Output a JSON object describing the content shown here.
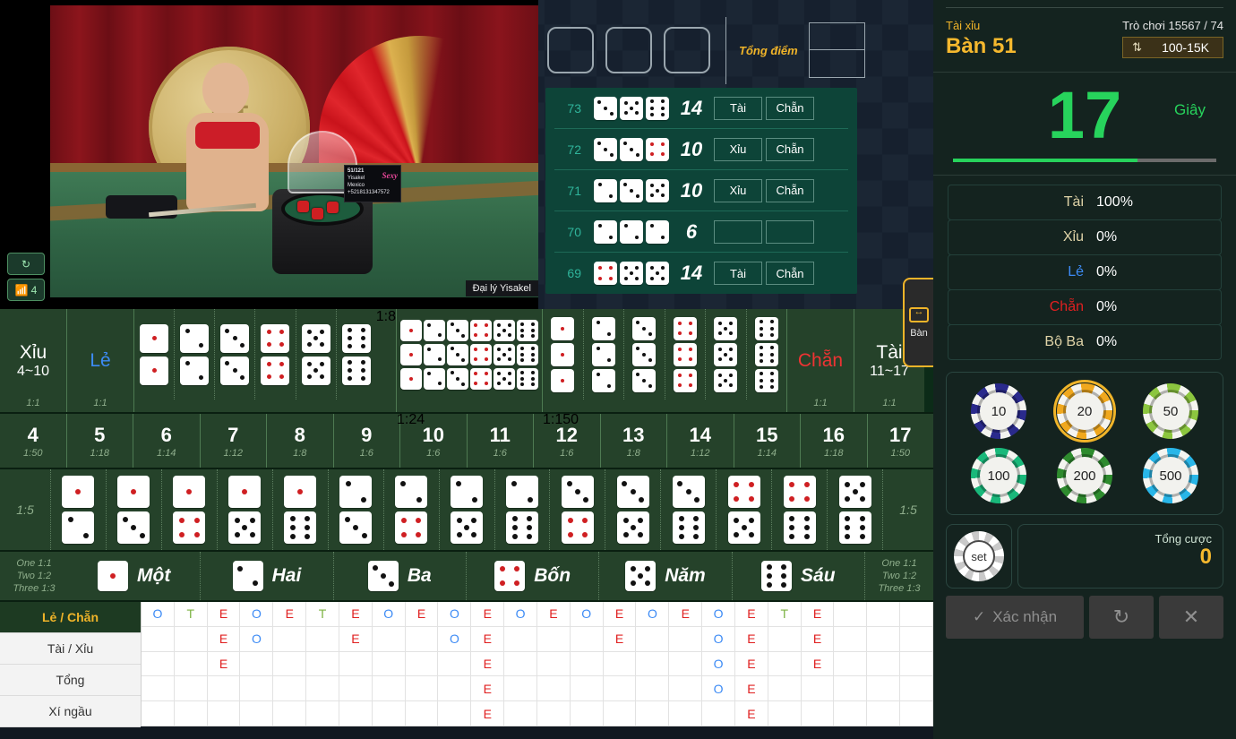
{
  "header": {
    "game_type": "Tài xỉu",
    "table_name": "Bàn 51",
    "game_number": "Trò chơi 15567 / 74",
    "limit": "100-15K",
    "limit_icon": "up-down-arrow-icon"
  },
  "timer": {
    "seconds": "17",
    "unit": "Giây",
    "progress_percent": 70
  },
  "stats": [
    {
      "label": "Tài",
      "value": "100%",
      "color": "#e0d4a8"
    },
    {
      "label": "Xỉu",
      "value": "0%",
      "color": "#e0d4a8"
    },
    {
      "label": "Lẻ",
      "value": "0%",
      "color": "#3d8bf5"
    },
    {
      "label": "Chẵn",
      "value": "0%",
      "color": "#e02020"
    },
    {
      "label": "Bộ Ba",
      "value": "0%",
      "color": "#e0d4a8"
    }
  ],
  "chips": [
    {
      "value": "10",
      "color": "#2a2a8c",
      "selected": false
    },
    {
      "value": "20",
      "color": "#f0a81e",
      "selected": true
    },
    {
      "value": "50",
      "color": "#8cc63f",
      "selected": false
    },
    {
      "value": "100",
      "color": "#19b87a",
      "selected": false
    },
    {
      "value": "200",
      "color": "#2e8b2e",
      "selected": false
    },
    {
      "value": "500",
      "color": "#29b6e8",
      "selected": false
    }
  ],
  "bet_controls": {
    "set_chip_label": "set",
    "total_bet_label": "Tổng cược",
    "total_bet_value": "0",
    "confirm_label": "Xác nhận",
    "repeat_icon": "repeat-icon",
    "clear_icon": "close-icon"
  },
  "side_tab": {
    "label": "Bàn",
    "icon": "resize-table-icon"
  },
  "video": {
    "refresh_icon": "refresh-icon",
    "signal_icon": "wifi-icon",
    "signal_level": "4",
    "dealer_label": "Đại lý Yisakel",
    "board": {
      "line1": "51/121",
      "line2": "Yisakel",
      "line3": "Mexico",
      "line4": "+5218131347572",
      "logo": "Sexy"
    }
  },
  "history_top": {
    "total_label": "Tổng điểm",
    "dice_slots": 3,
    "total_boxes": 2
  },
  "history": [
    {
      "round": "73",
      "dice": [
        3,
        5,
        6
      ],
      "dice_red": [
        false,
        false,
        false
      ],
      "sum": "14",
      "tags": [
        "Tài",
        "Chẵn"
      ]
    },
    {
      "round": "72",
      "dice": [
        3,
        3,
        4
      ],
      "dice_red": [
        false,
        false,
        true
      ],
      "sum": "10",
      "tags": [
        "Xỉu",
        "Chẵn"
      ]
    },
    {
      "round": "71",
      "dice": [
        2,
        3,
        5
      ],
      "dice_red": [
        false,
        false,
        false
      ],
      "sum": "10",
      "tags": [
        "Xỉu",
        "Chẵn"
      ]
    },
    {
      "round": "70",
      "dice": [
        2,
        2,
        2
      ],
      "dice_red": [
        false,
        false,
        false
      ],
      "sum": "6",
      "tags": [
        "",
        ""
      ]
    },
    {
      "round": "69",
      "dice": [
        4,
        5,
        5
      ],
      "dice_red": [
        true,
        false,
        false
      ],
      "sum": "14",
      "tags": [
        "Tài",
        "Chẵn"
      ]
    }
  ],
  "bet_table": {
    "xiu": {
      "title": "Xỉu",
      "range": "4~10",
      "odds": "1:1"
    },
    "le": {
      "title": "Lẻ",
      "odds": "1:1"
    },
    "chan": {
      "title": "Chẵn",
      "odds": "1:1"
    },
    "tai": {
      "title": "Tài",
      "range": "11~17",
      "odds": "1:1"
    },
    "pairs": {
      "odds": "1:8",
      "faces": [
        1,
        2,
        3,
        4,
        5,
        6
      ]
    },
    "any_triple": {
      "odds": "1:24",
      "faces": [
        1,
        2,
        3,
        4,
        5,
        6
      ]
    },
    "triples": {
      "odds": "1:150",
      "faces": [
        1,
        2,
        3,
        4,
        5,
        6
      ]
    },
    "totals": [
      {
        "n": "4",
        "odds": "1:50"
      },
      {
        "n": "5",
        "odds": "1:18"
      },
      {
        "n": "6",
        "odds": "1:14"
      },
      {
        "n": "7",
        "odds": "1:12"
      },
      {
        "n": "8",
        "odds": "1:8"
      },
      {
        "n": "9",
        "odds": "1:6"
      },
      {
        "n": "10",
        "odds": "1:6"
      },
      {
        "n": "11",
        "odds": "1:6"
      },
      {
        "n": "12",
        "odds": "1:6"
      },
      {
        "n": "13",
        "odds": "1:8"
      },
      {
        "n": "14",
        "odds": "1:12"
      },
      {
        "n": "15",
        "odds": "1:14"
      },
      {
        "n": "16",
        "odds": "1:18"
      },
      {
        "n": "17",
        "odds": "1:50"
      }
    ],
    "combos": {
      "odds_left": "1:5",
      "odds_right": "1:5",
      "pairs": [
        [
          1,
          2
        ],
        [
          1,
          3
        ],
        [
          1,
          4
        ],
        [
          1,
          5
        ],
        [
          1,
          6
        ],
        [
          2,
          3
        ],
        [
          2,
          4
        ],
        [
          2,
          5
        ],
        [
          2,
          6
        ],
        [
          3,
          4
        ],
        [
          3,
          5
        ],
        [
          3,
          6
        ],
        [
          4,
          5
        ],
        [
          4,
          6
        ],
        [
          5,
          6
        ]
      ]
    },
    "singles": {
      "odds_text": [
        "One 1:1",
        "Two 1:2",
        "Three 1:3"
      ],
      "items": [
        {
          "face": 1,
          "label": "Một"
        },
        {
          "face": 2,
          "label": "Hai"
        },
        {
          "face": 3,
          "label": "Ba"
        },
        {
          "face": 4,
          "label": "Bốn"
        },
        {
          "face": 5,
          "label": "Năm"
        },
        {
          "face": 6,
          "label": "Sáu"
        }
      ]
    }
  },
  "roadmap": {
    "tabs": [
      {
        "label": "Lẻ / Chẵn",
        "active": true
      },
      {
        "label": "Tài / Xỉu",
        "active": false
      },
      {
        "label": "Tổng",
        "active": false
      },
      {
        "label": "Xí ngầu",
        "active": false
      }
    ],
    "columns": 24,
    "rows": 5,
    "cells": [
      [
        "O",
        "",
        "",
        "",
        ""
      ],
      [
        "T",
        "",
        "",
        "",
        ""
      ],
      [
        "E",
        "E",
        "E",
        "",
        ""
      ],
      [
        "O",
        "O",
        "",
        "",
        ""
      ],
      [
        "E",
        "",
        "",
        "",
        ""
      ],
      [
        "T",
        "",
        "",
        "",
        ""
      ],
      [
        "E",
        "E",
        "",
        "",
        ""
      ],
      [
        "O",
        "",
        "",
        "",
        ""
      ],
      [
        "E",
        "",
        "",
        "",
        ""
      ],
      [
        "O",
        "O",
        "",
        "",
        ""
      ],
      [
        "E",
        "E",
        "E",
        "E",
        "E"
      ],
      [
        "O",
        "",
        "",
        "",
        ""
      ],
      [
        "E",
        "",
        "",
        "",
        ""
      ],
      [
        "O",
        "",
        "",
        "",
        ""
      ],
      [
        "E",
        "E",
        "",
        "",
        ""
      ],
      [
        "O",
        "",
        "",
        "",
        ""
      ],
      [
        "E",
        "",
        "",
        "",
        ""
      ],
      [
        "O",
        "O",
        "O",
        "O",
        ""
      ],
      [
        "E",
        "E",
        "E",
        "E",
        "E"
      ],
      [
        "T",
        "",
        "",
        "",
        ""
      ],
      [
        "E",
        "E",
        "E",
        "",
        ""
      ],
      [
        "",
        "",
        "",
        "",
        ""
      ],
      [
        "",
        "",
        "",
        "",
        ""
      ],
      [
        "",
        "",
        "",
        "",
        ""
      ]
    ]
  }
}
